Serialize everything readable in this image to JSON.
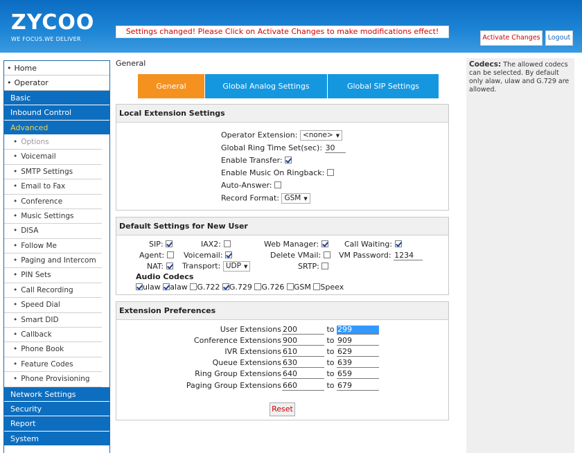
{
  "brand": {
    "name": "ZYCOO",
    "tagline": "WE FOCUS.WE DELIVER"
  },
  "notice": "Settings changed! Please Click on Activate Changes to make modifications effect!",
  "header_buttons": {
    "activate": "Activate Changes",
    "logout": "Logout"
  },
  "sidebar": {
    "home": "Home",
    "operator": "Operator",
    "basic": "Basic",
    "inbound": "Inbound Control",
    "advanced": "Advanced",
    "sub": [
      "Options",
      "Voicemail",
      "SMTP Settings",
      "Email to Fax",
      "Conference",
      "Music Settings",
      "DISA",
      "Follow Me",
      "Paging and Intercom",
      "PIN Sets",
      "Call Recording",
      "Speed Dial",
      "Smart DID",
      "Callback",
      "Phone Book",
      "Feature Codes",
      "Phone Provisioning"
    ],
    "network": "Network Settings",
    "security": "Security",
    "report": "Report",
    "system": "System"
  },
  "breadcrumb": "General",
  "tabs": [
    "General",
    "Global Analog Settings",
    "Global SIP Settings"
  ],
  "local": {
    "title": "Local Extension Settings",
    "operator_label": "Operator Extension:",
    "operator_value": "<none>",
    "ring_label": "Global Ring Time Set(sec):",
    "ring_value": "30",
    "transfer_label": "Enable Transfer:",
    "music_label": "Enable Music On Ringback:",
    "autoanswer_label": "Auto-Answer:",
    "record_label": "Record Format:",
    "record_value": "GSM"
  },
  "defaults": {
    "title": "Default Settings for New User",
    "sip": "SIP:",
    "iax2": "IAX2:",
    "webmanager": "Web Manager:",
    "callwaiting": "Call Waiting:",
    "agent": "Agent:",
    "voicemail": "Voicemail:",
    "deletevm": "Delete VMail:",
    "vmpassword": "VM Password:",
    "vmpassword_value": "1234",
    "nat": "NAT:",
    "transport": "Transport:",
    "transport_value": "UDP",
    "srtp": "SRTP:",
    "codecs_title": "Audio Codecs",
    "codecs": [
      "ulaw",
      "alaw",
      "G.722",
      "G.729",
      "G.726",
      "GSM",
      "Speex"
    ]
  },
  "prefs": {
    "title": "Extension Preferences",
    "to": "to",
    "rows": [
      {
        "label": "User Extensions",
        "from": "200",
        "to": "299"
      },
      {
        "label": "Conference Extensions",
        "from": "900",
        "to": "909"
      },
      {
        "label": "IVR Extensions",
        "from": "610",
        "to": "629"
      },
      {
        "label": "Queue Extensions",
        "from": "630",
        "to": "639"
      },
      {
        "label": "Ring Group Extensions",
        "from": "640",
        "to": "659"
      },
      {
        "label": "Paging Group Extensions",
        "from": "660",
        "to": "679"
      }
    ],
    "reset": "Reset"
  },
  "help": {
    "title": "Codecs:",
    "text": "The allowed codecs can be selected. By default only alaw, ulaw and G.729 are allowed."
  }
}
